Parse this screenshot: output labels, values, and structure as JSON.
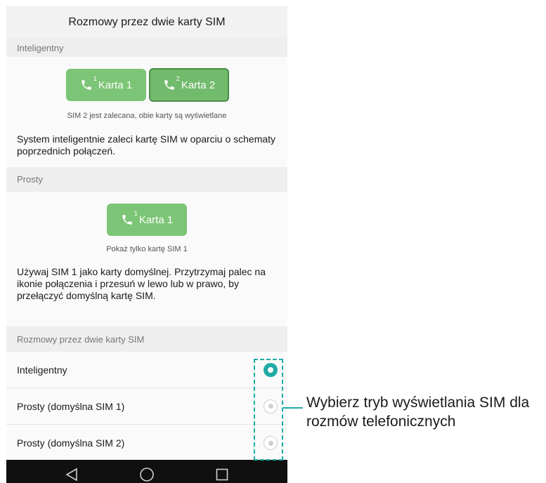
{
  "title": "Rozmowy przez dwie karty SIM",
  "smart": {
    "header": "Inteligentny",
    "btn1": {
      "label": "Karta 1",
      "num": "1"
    },
    "btn2": {
      "label": "Karta 2",
      "num": "2"
    },
    "caption": "SIM 2 jest zalecana, obie karty są wyświetlane",
    "description": "System inteligentnie zaleci kartę SIM w oparciu o schematy poprzednich połączeń."
  },
  "simple": {
    "header": "Prosty",
    "btn1": {
      "label": "Karta 1",
      "num": "1"
    },
    "caption": "Pokaż tylko kartę SIM 1",
    "description": "Używaj SIM 1 jako karty domyślnej. Przytrzymaj palec na ikonie połączenia i przesuń w lewo lub w prawo, by przełączyć domyślną kartę SIM."
  },
  "settings": {
    "header": "Rozmowy przez dwie karty SIM",
    "options": [
      {
        "label": "Inteligentny",
        "selected": true
      },
      {
        "label": "Prosty (domyślna SIM 1)",
        "selected": false
      },
      {
        "label": "Prosty (domyślna SIM 2)",
        "selected": false
      }
    ]
  },
  "nav": {
    "icons": [
      "back-icon",
      "home-icon",
      "recents-icon"
    ]
  },
  "callout": "Wybierz tryb wyświetlania SIM dla rozmów telefonicznych",
  "colors": {
    "accent": "#20aaa6",
    "sim_green": "#7cc576",
    "nav_bg": "#101010"
  }
}
